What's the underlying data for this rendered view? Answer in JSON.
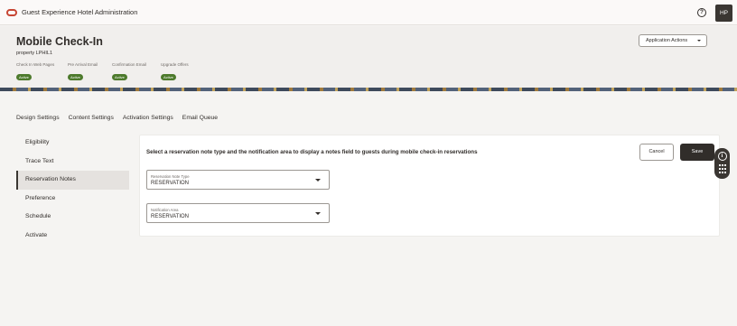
{
  "app": {
    "title": "Guest Experience Hotel Administration",
    "user_initials": "HP",
    "help_glyph": "?"
  },
  "header": {
    "title": "Mobile Check-In",
    "property": "property LPHIL1",
    "statuses": [
      {
        "label": "Check In Web Pages",
        "value": "Active"
      },
      {
        "label": "Pre Arrival Email",
        "value": "Active"
      },
      {
        "label": "Confirmation Email",
        "value": "Active"
      },
      {
        "label": "Upgrade Offers",
        "value": "Active"
      }
    ],
    "actions_label": "Application Actions"
  },
  "tabs": [
    "Design Settings",
    "Content Settings",
    "Activation Settings",
    "Email Queue"
  ],
  "nav": [
    "Eligibility",
    "Trace Text",
    "Reservation Notes",
    "Preference",
    "Schedule",
    "Activate"
  ],
  "nav_active": "Reservation Notes",
  "content": {
    "instruction": "Select a reservation note type and the notification area to display a notes field to guests during mobile check-in reservations",
    "cancel_label": "Cancel",
    "save_label": "Save",
    "fields": [
      {
        "label": "Reservation Note Type",
        "value": "RESERVATION"
      },
      {
        "label": "Notification Area",
        "value": "RESERVATION"
      }
    ]
  },
  "icons": {
    "logo": "oracle-logo",
    "help": "help-icon",
    "info": "info-icon",
    "tools": "grid-icon"
  },
  "colors": {
    "active_badge": "#4d7a2c",
    "primary_button": "#312d2a",
    "brand": "#c74634"
  }
}
